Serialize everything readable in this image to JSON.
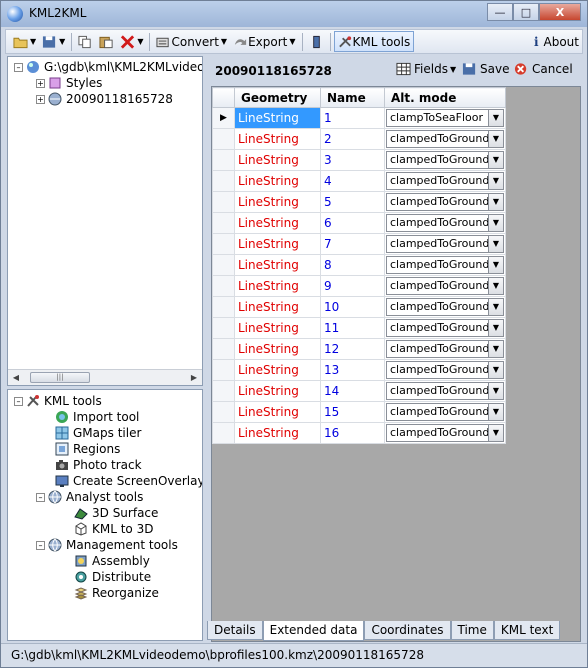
{
  "window": {
    "title": "KML2KML",
    "min_icon": "minimize-icon",
    "max_icon": "maximize-icon",
    "close_label": "X"
  },
  "toolbar": {
    "convert_label": "Convert",
    "export_label": "Export",
    "kml_tools_label": "KML tools",
    "about_label": "About",
    "about_glyph": "i"
  },
  "tree": {
    "root_label": "G:\\gdb\\kml\\KML2KMLvideode",
    "styles_label": "Styles",
    "record_label": "20090118165728"
  },
  "tools": {
    "root_label": "KML tools",
    "items": [
      "Import tool",
      "GMaps tiler",
      "Regions",
      "Photo track",
      "Create ScreenOverlay"
    ],
    "analyst_label": "Analyst tools",
    "analyst_items": [
      "3D Surface",
      "KML to 3D"
    ],
    "management_label": "Management tools",
    "management_items": [
      "Assembly",
      "Distribute",
      "Reorganize"
    ]
  },
  "record": {
    "title": "20090118165728",
    "fields_label": "Fields",
    "save_label": "Save",
    "cancel_label": "Cancel"
  },
  "grid": {
    "columns": [
      "Geometry",
      "Name",
      "Alt. mode"
    ],
    "rows": [
      {
        "geometry": "LineString",
        "name": "1",
        "alt": "clampToSeaFloor"
      },
      {
        "geometry": "LineString",
        "name": "2",
        "alt": "clampedToGround"
      },
      {
        "geometry": "LineString",
        "name": "3",
        "alt": "clampedToGround"
      },
      {
        "geometry": "LineString",
        "name": "4",
        "alt": "clampedToGround"
      },
      {
        "geometry": "LineString",
        "name": "5",
        "alt": "clampedToGround"
      },
      {
        "geometry": "LineString",
        "name": "6",
        "alt": "clampedToGround"
      },
      {
        "geometry": "LineString",
        "name": "7",
        "alt": "clampedToGround"
      },
      {
        "geometry": "LineString",
        "name": "8",
        "alt": "clampedToGround"
      },
      {
        "geometry": "LineString",
        "name": "9",
        "alt": "clampedToGround"
      },
      {
        "geometry": "LineString",
        "name": "10",
        "alt": "clampedToGround"
      },
      {
        "geometry": "LineString",
        "name": "11",
        "alt": "clampedToGround"
      },
      {
        "geometry": "LineString",
        "name": "12",
        "alt": "clampedToGround"
      },
      {
        "geometry": "LineString",
        "name": "13",
        "alt": "clampedToGround"
      },
      {
        "geometry": "LineString",
        "name": "14",
        "alt": "clampedToGround"
      },
      {
        "geometry": "LineString",
        "name": "15",
        "alt": "clampedToGround"
      },
      {
        "geometry": "LineString",
        "name": "16",
        "alt": "clampedToGround"
      }
    ]
  },
  "tabs": [
    "Details",
    "Extended data",
    "Coordinates",
    "Time",
    "KML text"
  ],
  "status": {
    "text": "G:\\gdb\\kml\\KML2KMLvideodemo\\bprofiles100.kmz\\20090118165728"
  },
  "colors": {
    "geometry_text": "#e00000",
    "name_text": "#0000e0",
    "selection": "#3399ff"
  }
}
